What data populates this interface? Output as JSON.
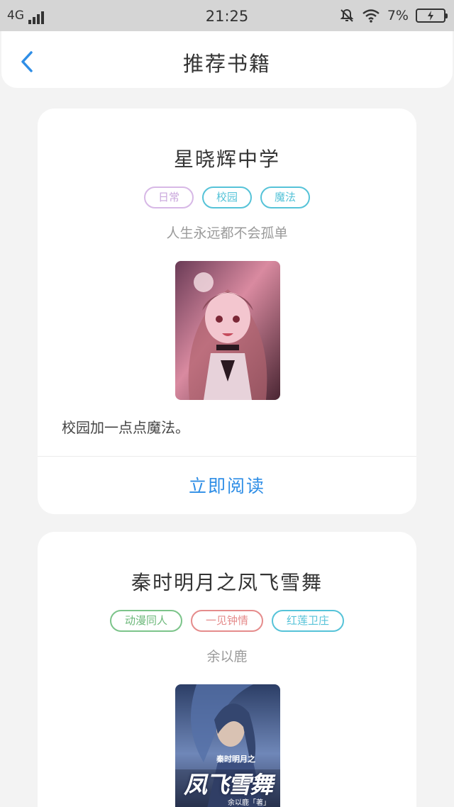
{
  "status_bar": {
    "network": "4G",
    "time": "21:25",
    "battery_pct": "7%"
  },
  "header": {
    "title": "推荐书籍",
    "back_icon": "chevron-left-icon"
  },
  "books": [
    {
      "title": "星晓辉中学",
      "tags": [
        {
          "label": "日常",
          "color": "#c9a6dc"
        },
        {
          "label": "校园",
          "color": "#56c3d8"
        },
        {
          "label": "魔法",
          "color": "#56c3d8"
        }
      ],
      "subtitle": "人生永远都不会孤单",
      "description": "校园加一点点魔法。",
      "action": "立即阅读"
    },
    {
      "title": "秦时明月之凤飞雪舞",
      "tags": [
        {
          "label": "动漫同人",
          "color": "#7cc48a"
        },
        {
          "label": "一见钟情",
          "color": "#e58c8c"
        },
        {
          "label": "红莲卫庄",
          "color": "#56c3d8"
        }
      ],
      "subtitle": "余以鹿",
      "cover_text": {
        "series": "秦时明月之",
        "name": "凤飞雪舞",
        "author": "余以鹿「著」"
      }
    }
  ],
  "colors": {
    "accent": "#2f8ee6",
    "background": "#f3f3f3"
  }
}
